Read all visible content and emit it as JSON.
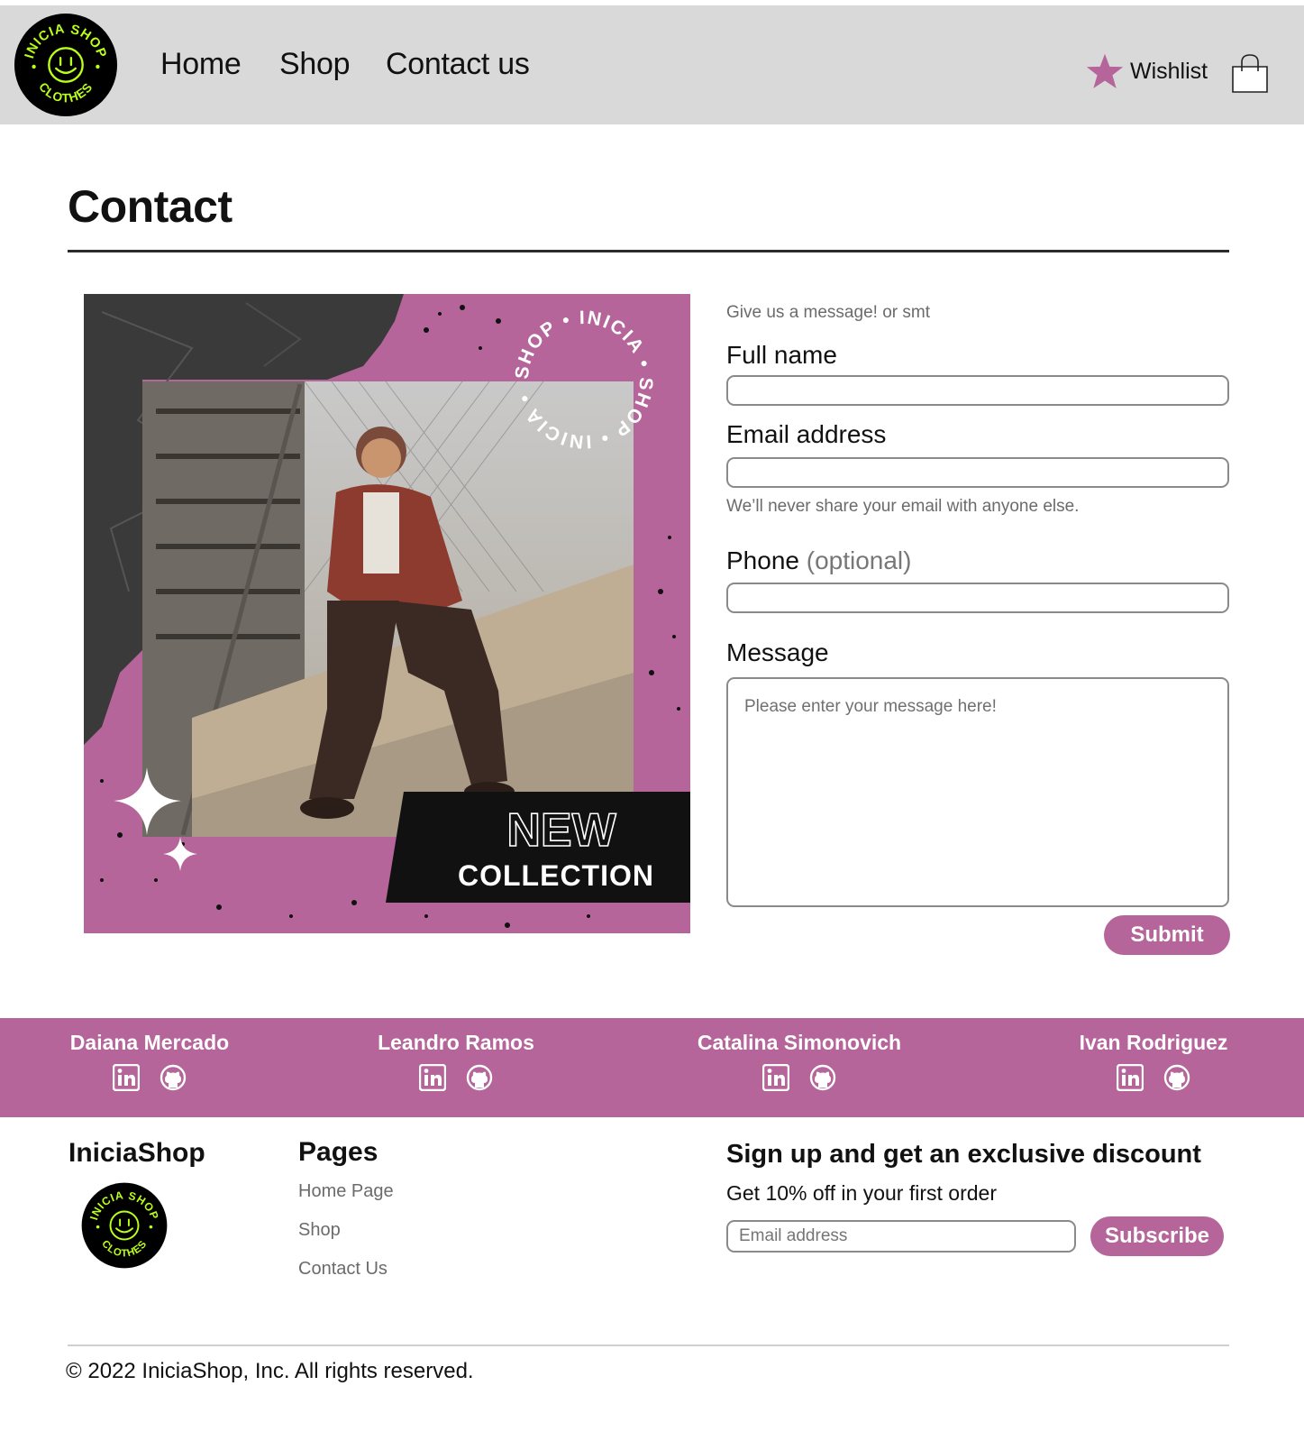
{
  "header": {
    "logo_text_top": "INICIA SHOP",
    "logo_text_bottom": "CLOTHES",
    "nav": [
      {
        "label": "Home"
      },
      {
        "label": "Shop"
      },
      {
        "label": "Contact us"
      }
    ],
    "wishlist_label": "Wishlist",
    "icons": {
      "wishlist": "star-icon",
      "cart": "shopping-bag-icon"
    },
    "colors": {
      "bar": "#d9d9d9",
      "accent": "#b5659a",
      "logo_bg": "#000000",
      "logo_text": "#b9ff1a"
    }
  },
  "main": {
    "title": "Contact",
    "promo": {
      "ring_text": "SHOP • INICIA • SHOP • INICIA •",
      "headline_1": "NEW",
      "headline_2": "COLLECTION"
    },
    "form": {
      "hint": "Give us a message! or smt",
      "full_name_label": "Full name",
      "email_label": "Email address",
      "email_help": "We’ll never share your email with anyone else.",
      "phone_label": "Phone",
      "phone_optional": "(optional)",
      "message_label": "Message",
      "message_placeholder": "Please enter your message here!",
      "submit_label": "Submit"
    }
  },
  "team": [
    {
      "name": "Daiana Mercado"
    },
    {
      "name": "Leandro Ramos"
    },
    {
      "name": "Catalina Simonovich"
    },
    {
      "name": "Ivan Rodriguez"
    }
  ],
  "footer": {
    "brand_name": "IniciaShop",
    "pages_title": "Pages",
    "pages": [
      {
        "label": "Home Page"
      },
      {
        "label": "Shop"
      },
      {
        "label": "Contact Us"
      }
    ],
    "signup_title": "Sign up and get an exclusive discount",
    "signup_subtitle": "Get 10% off in your first order",
    "email_placeholder": "Email address",
    "subscribe_label": "Subscribe",
    "copyright": "© 2022 IniciaShop, Inc. All rights reserved."
  }
}
